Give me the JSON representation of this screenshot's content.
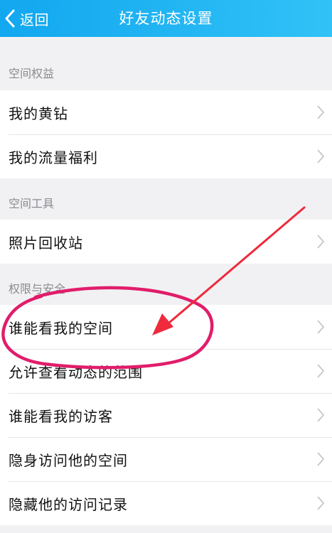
{
  "header": {
    "back_label": "返回",
    "title": "好友动态设置"
  },
  "sections": [
    {
      "title": "空间权益",
      "items": [
        "我的黄钻",
        "我的流量福利"
      ]
    },
    {
      "title": "空间工具",
      "items": [
        "照片回收站"
      ]
    },
    {
      "title": "权限与安全",
      "items": [
        "谁能看我的空间",
        "允许查看动态的范围",
        "谁能看我的访客",
        "隐身访问他的空间",
        "隐藏他的访问记录"
      ]
    }
  ],
  "colors": {
    "header_start": "#12a7ef",
    "header_end": "#31c2f6",
    "annotation": "#e11d6a"
  },
  "icons": {
    "back": "chevron-left-icon",
    "row": "chevron-right-icon"
  }
}
